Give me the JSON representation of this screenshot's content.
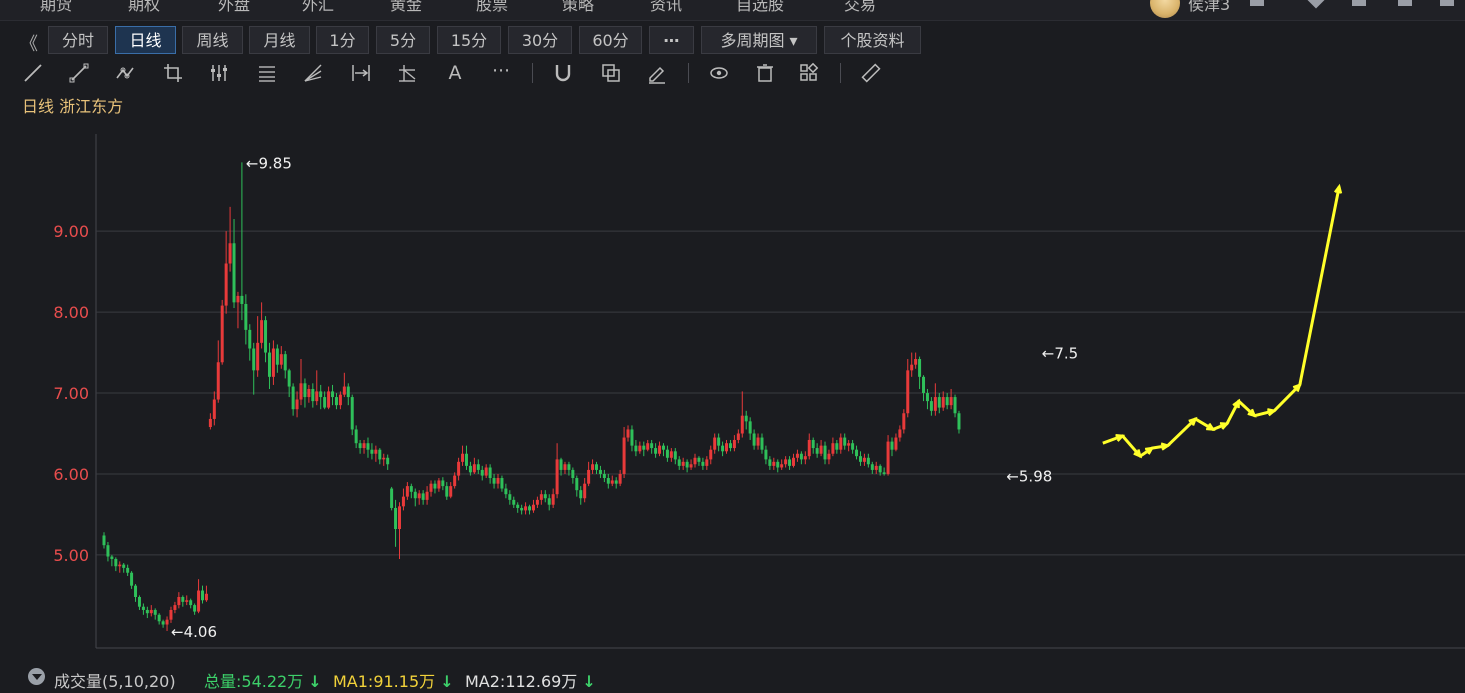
{
  "topbar": {
    "menu": [
      "期货",
      "期权",
      "外盘",
      "外汇",
      "黄金",
      "股票",
      "策略",
      "资讯",
      "自选股",
      "交易"
    ],
    "username": "侯津3"
  },
  "periods": [
    "分时",
    "日线",
    "周线",
    "月线",
    "1分",
    "5分",
    "15分",
    "30分",
    "60分",
    "⋯",
    "多周期图 ▾",
    "个股资料"
  ],
  "active_period": "日线",
  "chart_title": {
    "period": "日线",
    "stock": "浙江东方"
  },
  "volume_bar": {
    "label": "成交量(5,10,20)",
    "total": "总量:54.22万",
    "ma1": "MA1:91.15万",
    "ma2": "MA2:112.69万"
  },
  "colors": {
    "up": "#e83a3a",
    "down": "#2fc05a",
    "axis_label": "#e84d4d",
    "grid": "#3a3b41",
    "annotation": "#ffff2a",
    "title": "#e8c27a"
  },
  "chart_data": {
    "type": "candlestick",
    "title": "日线 浙江东方",
    "ylim": [
      3.85,
      10.2
    ],
    "yticks": [
      "5.00",
      "6.00",
      "7.00",
      "8.00",
      "9.00"
    ],
    "ytick_values": [
      5,
      6,
      7,
      8,
      9
    ],
    "marks": [
      {
        "label": "9.85",
        "index": 35,
        "value": 9.85
      },
      {
        "label": "4.06",
        "index": 16,
        "value": 4.06
      },
      {
        "label": "7.5",
        "index": 237,
        "value": 7.5
      },
      {
        "label": "5.98",
        "index": 228,
        "value": 5.98
      }
    ],
    "candles": [
      [
        5.24,
        5.12,
        5.28,
        5.08
      ],
      [
        5.12,
        4.98,
        5.16,
        4.92
      ],
      [
        4.98,
        4.95,
        5.0,
        4.86
      ],
      [
        4.95,
        4.86,
        4.97,
        4.8
      ],
      [
        4.86,
        4.88,
        4.92,
        4.78
      ],
      [
        4.88,
        4.84,
        4.9,
        4.78
      ],
      [
        4.84,
        4.78,
        4.88,
        4.74
      ],
      [
        4.78,
        4.62,
        4.8,
        4.58
      ],
      [
        4.62,
        4.48,
        4.64,
        4.42
      ],
      [
        4.48,
        4.36,
        4.5,
        4.32
      ],
      [
        4.36,
        4.32,
        4.4,
        4.26
      ],
      [
        4.32,
        4.28,
        4.36,
        4.22
      ],
      [
        4.28,
        4.32,
        4.38,
        4.24
      ],
      [
        4.32,
        4.26,
        4.34,
        4.2
      ],
      [
        4.26,
        4.18,
        4.28,
        4.14
      ],
      [
        4.18,
        4.14,
        4.2,
        4.1
      ],
      [
        4.14,
        4.2,
        4.24,
        4.06
      ],
      [
        4.2,
        4.32,
        4.36,
        4.16
      ],
      [
        4.32,
        4.38,
        4.42,
        4.28
      ],
      [
        4.38,
        4.48,
        4.54,
        4.34
      ],
      [
        4.48,
        4.42,
        4.5,
        4.36
      ],
      [
        4.42,
        4.44,
        4.5,
        4.38
      ],
      [
        4.44,
        4.38,
        4.46,
        4.34
      ],
      [
        4.38,
        4.3,
        4.4,
        4.26
      ],
      [
        4.3,
        4.56,
        4.7,
        4.28
      ],
      [
        4.56,
        4.44,
        4.62,
        4.4
      ],
      [
        4.44,
        4.52,
        4.62,
        4.42
      ],
      [
        6.58,
        6.68,
        6.75,
        6.55
      ],
      [
        6.68,
        6.92,
        7.02,
        6.6
      ],
      [
        6.92,
        7.38,
        7.65,
        6.88
      ],
      [
        7.38,
        8.08,
        8.15,
        7.35
      ],
      [
        8.08,
        8.6,
        9.0,
        7.98
      ],
      [
        8.6,
        8.85,
        9.3,
        8.5
      ],
      [
        8.85,
        8.12,
        9.15,
        8.05
      ],
      [
        8.12,
        8.2,
        8.25,
        7.8
      ],
      [
        8.2,
        8.1,
        9.85,
        7.9
      ],
      [
        8.1,
        7.78,
        8.22,
        7.6
      ],
      [
        7.78,
        7.55,
        7.85,
        7.4
      ],
      [
        7.55,
        7.28,
        7.62,
        6.98
      ],
      [
        7.28,
        7.62,
        7.95,
        7.2
      ],
      [
        7.62,
        7.9,
        8.12,
        7.55
      ],
      [
        7.9,
        7.5,
        7.95,
        7.38
      ],
      [
        7.5,
        7.2,
        7.62,
        7.05
      ],
      [
        7.2,
        7.55,
        7.65,
        7.1
      ],
      [
        7.55,
        7.35,
        7.6,
        7.25
      ],
      [
        7.35,
        7.48,
        7.58,
        7.3
      ],
      [
        7.48,
        7.28,
        7.52,
        7.18
      ],
      [
        7.28,
        7.08,
        7.3,
        6.95
      ],
      [
        7.08,
        6.8,
        7.12,
        6.72
      ],
      [
        6.8,
        6.92,
        7.02,
        6.7
      ],
      [
        6.92,
        7.12,
        7.42,
        6.85
      ],
      [
        7.12,
        6.95,
        7.18,
        6.82
      ],
      [
        6.95,
        7.05,
        7.1,
        6.88
      ],
      [
        7.05,
        6.9,
        7.12,
        6.82
      ],
      [
        6.9,
        7.02,
        7.28,
        6.85
      ],
      [
        7.02,
        6.95,
        7.1,
        6.8
      ],
      [
        6.95,
        6.82,
        7.02,
        6.8
      ],
      [
        6.82,
        7.02,
        7.08,
        6.8
      ],
      [
        7.02,
        6.95,
        7.1,
        6.85
      ],
      [
        6.95,
        6.85,
        7.0,
        6.8
      ],
      [
        6.85,
        6.98,
        7.02,
        6.8
      ],
      [
        6.98,
        7.08,
        7.25,
        6.95
      ],
      [
        7.08,
        6.95,
        7.12,
        6.85
      ],
      [
        6.95,
        6.55,
        6.98,
        6.48
      ],
      [
        6.55,
        6.38,
        6.6,
        6.32
      ],
      [
        6.38,
        6.32,
        6.42,
        6.25
      ],
      [
        6.32,
        6.38,
        6.42,
        6.25
      ],
      [
        6.38,
        6.3,
        6.45,
        6.2
      ],
      [
        6.3,
        6.25,
        6.38,
        6.18
      ],
      [
        6.25,
        6.3,
        6.35,
        6.15
      ],
      [
        6.3,
        6.18,
        6.32,
        6.12
      ],
      [
        6.18,
        6.2,
        6.25,
        6.1
      ],
      [
        6.2,
        6.12,
        6.24,
        6.05
      ],
      [
        5.82,
        5.58,
        5.84,
        5.55
      ],
      [
        5.58,
        5.32,
        5.68,
        5.1
      ],
      [
        5.32,
        5.6,
        5.65,
        4.95
      ],
      [
        5.6,
        5.72,
        5.82,
        5.55
      ],
      [
        5.72,
        5.85,
        5.9,
        5.68
      ],
      [
        5.85,
        5.78,
        5.88,
        5.7
      ],
      [
        5.78,
        5.7,
        5.82,
        5.6
      ],
      [
        5.7,
        5.76,
        5.8,
        5.62
      ],
      [
        5.76,
        5.68,
        5.8,
        5.62
      ],
      [
        5.68,
        5.78,
        5.85,
        5.62
      ],
      [
        5.78,
        5.88,
        5.92,
        5.72
      ],
      [
        5.88,
        5.82,
        5.92,
        5.76
      ],
      [
        5.82,
        5.92,
        5.95,
        5.78
      ],
      [
        5.92,
        5.85,
        5.96,
        5.8
      ],
      [
        5.85,
        5.72,
        5.9,
        5.68
      ],
      [
        5.72,
        5.85,
        5.9,
        5.7
      ],
      [
        5.85,
        5.98,
        6.02,
        5.82
      ],
      [
        5.98,
        6.15,
        6.2,
        5.92
      ],
      [
        6.15,
        6.25,
        6.35,
        6.1
      ],
      [
        6.25,
        6.1,
        6.35,
        6.05
      ],
      [
        6.1,
        6.02,
        6.15,
        5.98
      ],
      [
        6.02,
        6.12,
        6.2,
        6.0
      ],
      [
        6.12,
        6.05,
        6.18,
        6.0
      ],
      [
        6.05,
        5.98,
        6.1,
        5.92
      ],
      [
        5.98,
        6.08,
        6.12,
        5.95
      ],
      [
        6.08,
        5.95,
        6.12,
        5.88
      ],
      [
        5.95,
        5.88,
        6.0,
        5.82
      ],
      [
        5.88,
        5.95,
        6.0,
        5.82
      ],
      [
        5.95,
        5.82,
        5.98,
        5.78
      ],
      [
        5.82,
        5.75,
        5.88,
        5.7
      ],
      [
        5.75,
        5.68,
        5.8,
        5.62
      ],
      [
        5.68,
        5.62,
        5.72,
        5.58
      ],
      [
        5.62,
        5.58,
        5.65,
        5.52
      ],
      [
        5.58,
        5.55,
        5.62,
        5.5
      ],
      [
        5.55,
        5.6,
        5.65,
        5.5
      ],
      [
        5.6,
        5.55,
        5.62,
        5.5
      ],
      [
        5.55,
        5.62,
        5.68,
        5.52
      ],
      [
        5.62,
        5.68,
        5.72,
        5.58
      ],
      [
        5.68,
        5.75,
        5.8,
        5.62
      ],
      [
        5.75,
        5.7,
        5.8,
        5.65
      ],
      [
        5.7,
        5.62,
        5.75,
        5.55
      ],
      [
        5.62,
        5.75,
        5.82,
        5.58
      ],
      [
        5.75,
        6.18,
        6.38,
        5.7
      ],
      [
        6.18,
        6.05,
        6.2,
        5.98
      ],
      [
        6.05,
        6.12,
        6.15,
        6.0
      ],
      [
        6.12,
        6.05,
        6.15,
        5.98
      ],
      [
        6.05,
        5.95,
        6.08,
        5.88
      ],
      [
        5.95,
        5.8,
        5.98,
        5.72
      ],
      [
        5.8,
        5.7,
        5.85,
        5.62
      ],
      [
        5.7,
        5.88,
        5.95,
        5.65
      ],
      [
        5.88,
        6.05,
        6.15,
        5.85
      ],
      [
        6.05,
        6.12,
        6.18,
        6.0
      ],
      [
        6.12,
        6.05,
        6.15,
        6.0
      ],
      [
        6.05,
        6.0,
        6.1,
        5.95
      ],
      [
        6.0,
        5.95,
        6.05,
        5.9
      ],
      [
        5.95,
        5.88,
        6.0,
        5.82
      ],
      [
        5.88,
        5.92,
        5.98,
        5.85
      ],
      [
        5.92,
        5.88,
        5.96,
        5.82
      ],
      [
        5.88,
        6.0,
        6.05,
        5.85
      ],
      [
        6.0,
        6.45,
        6.58,
        5.95
      ],
      [
        6.45,
        6.55,
        6.6,
        6.4
      ],
      [
        6.55,
        6.35,
        6.6,
        6.28
      ],
      [
        6.35,
        6.28,
        6.42,
        6.22
      ],
      [
        6.28,
        6.35,
        6.4,
        6.25
      ],
      [
        6.35,
        6.3,
        6.4,
        6.22
      ],
      [
        6.3,
        6.38,
        6.42,
        6.28
      ],
      [
        6.38,
        6.32,
        6.42,
        6.25
      ],
      [
        6.32,
        6.25,
        6.38,
        6.2
      ],
      [
        6.25,
        6.35,
        6.4,
        6.22
      ],
      [
        6.35,
        6.3,
        6.38,
        6.22
      ],
      [
        6.3,
        6.2,
        6.35,
        6.15
      ],
      [
        6.2,
        6.28,
        6.32,
        6.15
      ],
      [
        6.28,
        6.18,
        6.32,
        6.12
      ],
      [
        6.18,
        6.1,
        6.22,
        6.05
      ],
      [
        6.1,
        6.15,
        6.2,
        6.05
      ],
      [
        6.15,
        6.08,
        6.18,
        6.02
      ],
      [
        6.08,
        6.12,
        6.18,
        6.05
      ],
      [
        6.12,
        6.2,
        6.25,
        6.08
      ],
      [
        6.2,
        6.15,
        6.22,
        6.1
      ],
      [
        6.15,
        6.1,
        6.2,
        6.05
      ],
      [
        6.1,
        6.18,
        6.22,
        6.05
      ],
      [
        6.18,
        6.3,
        6.35,
        6.12
      ],
      [
        6.3,
        6.45,
        6.5,
        6.25
      ],
      [
        6.45,
        6.35,
        6.5,
        6.28
      ],
      [
        6.35,
        6.28,
        6.4,
        6.22
      ],
      [
        6.28,
        6.38,
        6.42,
        6.25
      ],
      [
        6.38,
        6.32,
        6.42,
        6.28
      ],
      [
        6.32,
        6.42,
        6.48,
        6.28
      ],
      [
        6.42,
        6.5,
        6.55,
        6.38
      ],
      [
        6.5,
        6.72,
        7.02,
        6.45
      ],
      [
        6.72,
        6.65,
        6.78,
        6.55
      ],
      [
        6.65,
        6.5,
        6.7,
        6.42
      ],
      [
        6.5,
        6.35,
        6.55,
        6.3
      ],
      [
        6.35,
        6.45,
        6.5,
        6.3
      ],
      [
        6.45,
        6.3,
        6.5,
        6.25
      ],
      [
        6.3,
        6.18,
        6.35,
        6.12
      ],
      [
        6.18,
        6.1,
        6.22,
        6.05
      ],
      [
        6.1,
        6.15,
        6.2,
        6.05
      ],
      [
        6.15,
        6.08,
        6.18,
        6.02
      ],
      [
        6.08,
        6.12,
        6.18,
        6.05
      ],
      [
        6.12,
        6.18,
        6.22,
        6.08
      ],
      [
        6.18,
        6.1,
        6.22,
        6.05
      ],
      [
        6.1,
        6.2,
        6.25,
        6.08
      ],
      [
        6.2,
        6.25,
        6.3,
        6.15
      ],
      [
        6.25,
        6.18,
        6.28,
        6.12
      ],
      [
        6.18,
        6.22,
        6.28,
        6.12
      ],
      [
        6.22,
        6.42,
        6.5,
        6.18
      ],
      [
        6.42,
        6.32,
        6.45,
        6.25
      ],
      [
        6.32,
        6.25,
        6.38,
        6.2
      ],
      [
        6.25,
        6.35,
        6.42,
        6.22
      ],
      [
        6.35,
        6.18,
        6.4,
        6.12
      ],
      [
        6.18,
        6.25,
        6.3,
        6.12
      ],
      [
        6.25,
        6.38,
        6.45,
        6.22
      ],
      [
        6.38,
        6.3,
        6.42,
        6.25
      ],
      [
        6.3,
        6.45,
        6.5,
        6.25
      ],
      [
        6.45,
        6.35,
        6.5,
        6.3
      ],
      [
        6.35,
        6.38,
        6.42,
        6.28
      ],
      [
        6.38,
        6.3,
        6.42,
        6.25
      ],
      [
        6.3,
        6.22,
        6.35,
        6.18
      ],
      [
        6.22,
        6.15,
        6.28,
        6.1
      ],
      [
        6.15,
        6.2,
        6.25,
        6.1
      ],
      [
        6.2,
        6.12,
        6.25,
        6.08
      ],
      [
        6.12,
        6.05,
        6.15,
        6.0
      ],
      [
        6.05,
        6.1,
        6.15,
        6.0
      ],
      [
        6.1,
        6.02,
        6.12,
        5.98
      ],
      [
        6.02,
        6.0,
        6.08,
        5.98
      ],
      [
        6.0,
        6.4,
        6.48,
        5.98
      ],
      [
        6.4,
        6.3,
        6.45,
        6.22
      ],
      [
        6.3,
        6.45,
        6.5,
        6.28
      ],
      [
        6.45,
        6.55,
        6.6,
        6.4
      ],
      [
        6.55,
        6.75,
        6.8,
        6.5
      ],
      [
        6.75,
        7.28,
        7.42,
        6.7
      ],
      [
        7.28,
        7.35,
        7.5,
        7.2
      ],
      [
        7.35,
        7.42,
        7.5,
        7.3
      ],
      [
        7.42,
        7.2,
        7.45,
        7.05
      ],
      [
        7.2,
        7.0,
        7.22,
        6.9
      ],
      [
        7.0,
        6.9,
        7.05,
        6.8
      ],
      [
        6.9,
        6.78,
        6.95,
        6.72
      ],
      [
        6.78,
        6.95,
        7.12,
        6.72
      ],
      [
        6.95,
        6.82,
        7.0,
        6.75
      ],
      [
        6.82,
        6.95,
        7.02,
        6.78
      ],
      [
        6.95,
        6.85,
        7.0,
        6.8
      ],
      [
        6.85,
        6.95,
        7.05,
        6.8
      ],
      [
        6.95,
        6.75,
        6.98,
        6.7
      ],
      [
        6.75,
        6.55,
        6.78,
        6.5
      ]
    ],
    "annotation_path": [
      [
        6.55,
        6.38
      ],
      [
        6.62,
        6.47
      ],
      [
        6.44,
        6.22
      ],
      [
        6.5,
        6.32
      ],
      [
        6.48,
        6.35
      ],
      [
        6.6,
        6.68
      ],
      [
        6.7,
        6.55
      ],
      [
        6.75,
        6.62
      ],
      [
        6.58,
        6.9
      ],
      [
        6.95,
        6.72
      ],
      [
        6.85,
        6.78
      ],
      [
        7.15,
        7.1
      ],
      [
        8.45,
        9.55
      ]
    ]
  }
}
